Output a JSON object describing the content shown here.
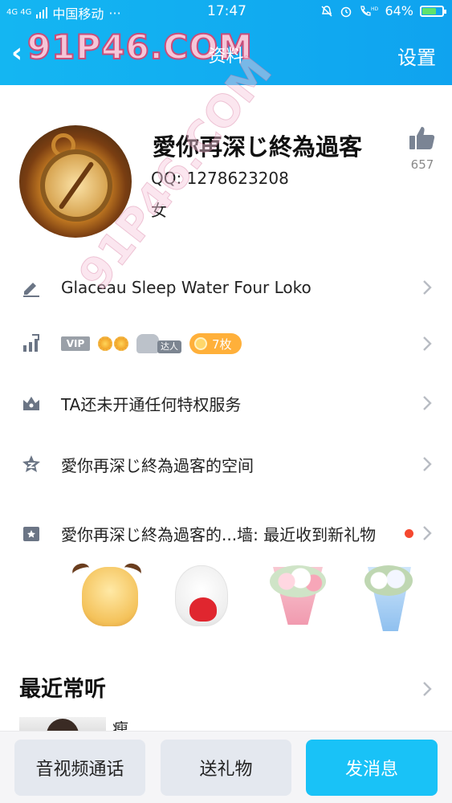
{
  "status_bar": {
    "signal": "4G 4G",
    "carrier": "中国移动",
    "dots": "···",
    "time": "17:47",
    "battery_percent": "64%",
    "battery_level": 0.64,
    "hd": "HD"
  },
  "header": {
    "title": "资料",
    "settings_label": "设置",
    "watermark": "91P46.COM"
  },
  "profile": {
    "name": "愛你再深じ終為過客",
    "qq_label": "QQ:",
    "qq_number": "1278623208",
    "gender": "女",
    "like_count": "657"
  },
  "rows": {
    "signature": "Glaceau Sleep Water Four Loko",
    "badges": {
      "vip": "VIP",
      "daren": "达人",
      "coins": "7枚"
    },
    "privilege": "TA还未开通任何特权服务",
    "space": "愛你再深じ終為過客的空间",
    "gift_wall": "愛你再深じ終為過客的...墙: 最近收到新礼物"
  },
  "recent": {
    "title": "最近常听",
    "first_item_partial": "瘦"
  },
  "bottom_bar": {
    "call": "音视频通话",
    "gift": "送礼物",
    "message": "发消息"
  },
  "colors": {
    "header_blue": "#14b6f2",
    "primary_button": "#19c2f7",
    "secondary_button": "#e4e8ef",
    "coins_orange": "#ffb03a",
    "red_dot": "#f5482f"
  },
  "icons": [
    "back-icon",
    "thumbs-up-icon",
    "pencil-icon",
    "level-chart-icon",
    "crown-icon",
    "qzone-icon",
    "gift-wall-icon",
    "chevron-right-icon",
    "bell-muted-icon",
    "alarm-icon",
    "phone-hd-icon",
    "battery-icon"
  ]
}
